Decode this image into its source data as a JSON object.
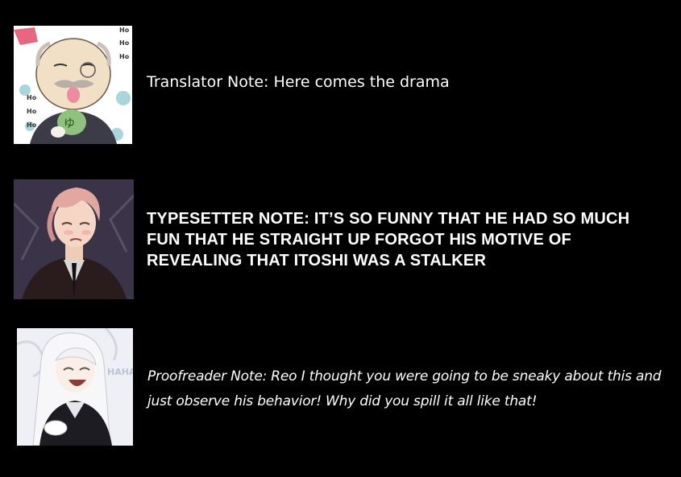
{
  "notes": [
    {
      "role": "translator",
      "avatar_icon": "old-man-avatar-icon",
      "text": "Translator Note: Here comes the drama"
    },
    {
      "role": "typesetter",
      "avatar_icon": "pink-haired-man-avatar-icon",
      "text": "TYPESETTER NOTE: IT’S SO FUNNY THAT HE HAD SO MUCH FUN THAT HE STRAIGHT UP FORGOT HIS MOTIVE OF REVEALING THAT ITOSHI WAS A STALKER"
    },
    {
      "role": "proofreader",
      "avatar_icon": "white-haired-man-avatar-icon",
      "text": "Proofreader Note: Reo I thought you were going to be sneaky about this and just observe his behavior! Why did you spill it all like that!"
    }
  ],
  "avatar_decorations": {
    "ho_marks": [
      "Ho",
      "Ho",
      "Ho",
      "Ho",
      "Ho",
      "Ho"
    ],
    "seal_glyph": "ゆ",
    "haha_mark": "HAHA"
  },
  "colors": {
    "background": "#000000",
    "text": "#ffffff"
  }
}
